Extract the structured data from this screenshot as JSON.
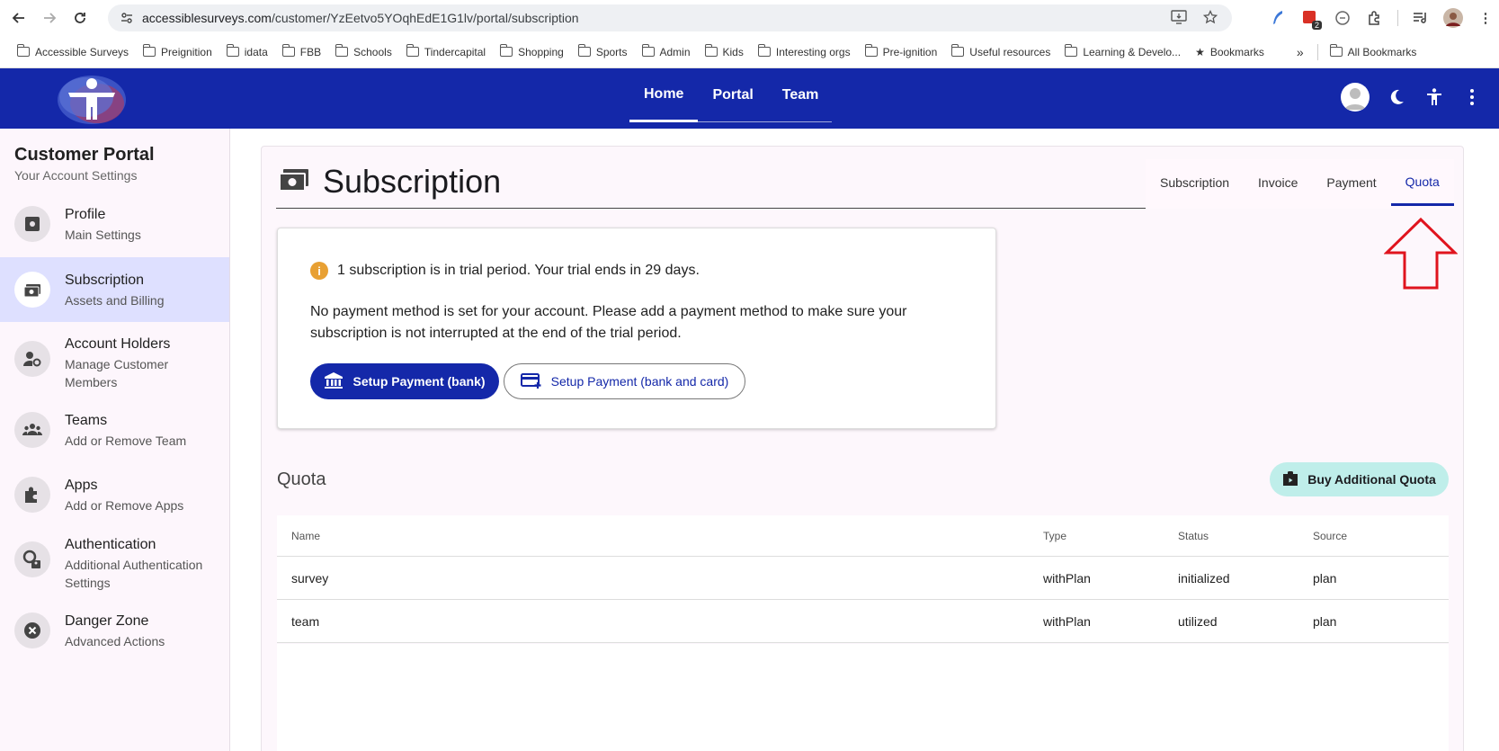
{
  "browser": {
    "url_host": "accessiblesurveys.com",
    "url_path": "/customer/YzEetvo5YOqhEdE1G1lv/portal/subscription",
    "bookmarks": [
      "Accessible Surveys",
      "Preignition",
      "idata",
      "FBB",
      "Schools",
      "Tindercapital",
      "Shopping",
      "Sports",
      "Admin",
      "Kids",
      "Interesting orgs",
      "Pre-ignition",
      "Useful resources",
      "Learning & Develo..."
    ],
    "bookmarks_starred": "Bookmarks",
    "bookmarks_more": "»",
    "all_bookmarks": "All Bookmarks",
    "ext_badge": "2"
  },
  "header": {
    "nav": [
      "Home",
      "Portal",
      "Team"
    ]
  },
  "sidebar": {
    "title": "Customer Portal",
    "subtitle": "Your Account Settings",
    "items": [
      {
        "label": "Profile",
        "sub": "Main Settings",
        "icon": "gear-icon"
      },
      {
        "label": "Subscription",
        "sub": "Assets and Billing",
        "icon": "money-icon"
      },
      {
        "label": "Account Holders",
        "sub": "Manage Customer Members",
        "icon": "manage-account-icon"
      },
      {
        "label": "Teams",
        "sub": "Add or Remove Team",
        "icon": "groups-icon"
      },
      {
        "label": "Apps",
        "sub": "Add or Remove Apps",
        "icon": "puzzle-icon"
      },
      {
        "label": "Authentication",
        "sub": "Additional Authentication Settings",
        "icon": "auth-icon"
      },
      {
        "label": "Danger Zone",
        "sub": "Advanced Actions",
        "icon": "cancel-icon"
      }
    ]
  },
  "main": {
    "title": "Subscription",
    "tabs": [
      "Subscription",
      "Invoice",
      "Payment",
      "Quota"
    ],
    "trial_notice": "1 subscription is in trial period. Your trial ends in 29 days.",
    "payment_notice": "No payment method is set for your account. Please add a payment method to make sure your subscription is not interrupted at the end of the trial period.",
    "setup_bank_label": "Setup Payment (bank)",
    "setup_card_label": "Setup Payment (bank and card)",
    "quota_title": "Quota",
    "buy_quota_label": "Buy Additional Quota",
    "table": {
      "headers": [
        "Name",
        "Type",
        "Status",
        "Source"
      ],
      "rows": [
        [
          "survey",
          "withPlan",
          "initialized",
          "plan"
        ],
        [
          "team",
          "withPlan",
          "utilized",
          "plan"
        ]
      ]
    }
  },
  "colors": {
    "brand": "#1428a9",
    "sidebar_active": "#dee0ff",
    "quota_button": "#bfeeea",
    "warning": "#e8a033",
    "annotation_arrow": "#e0141e"
  }
}
